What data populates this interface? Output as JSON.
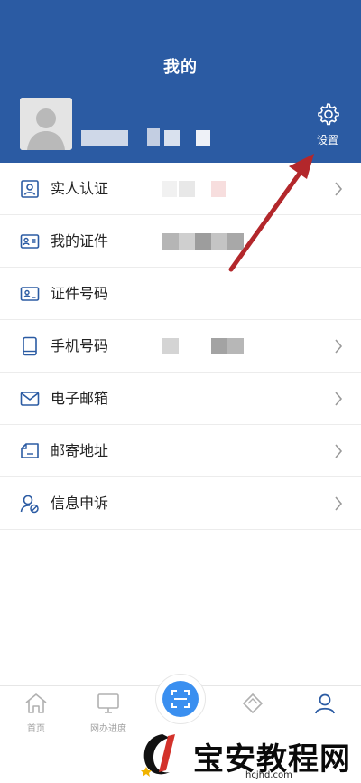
{
  "header": {
    "title": "我的",
    "settings_label": "设置",
    "accent": "#2b5ba3"
  },
  "list": {
    "items": [
      {
        "label": "实人认证",
        "icon": "id-card-person-icon",
        "chevron": true
      },
      {
        "label": "我的证件",
        "icon": "certificate-card-icon",
        "chevron": false
      },
      {
        "label": "证件号码",
        "icon": "id-number-card-icon",
        "chevron": false
      },
      {
        "label": "手机号码",
        "icon": "mobile-phone-icon",
        "chevron": true
      },
      {
        "label": "电子邮箱",
        "icon": "mail-icon",
        "chevron": true
      },
      {
        "label": "邮寄地址",
        "icon": "address-tag-icon",
        "chevron": true
      },
      {
        "label": "信息申诉",
        "icon": "user-appeal-icon",
        "chevron": true
      }
    ]
  },
  "nav": {
    "items": [
      {
        "label": "首页",
        "icon": "home-icon"
      },
      {
        "label": "网办进度",
        "icon": "monitor-icon"
      },
      {
        "label": "",
        "icon": "scan-icon"
      },
      {
        "label": "",
        "icon": "diamond-icon"
      },
      {
        "label": "",
        "icon": "user-icon"
      }
    ],
    "active_color": "#2b5ba3",
    "inactive_color": "#a2a2a2"
  },
  "watermark": {
    "text": "宝安教程网",
    "url": "hcjhd.com"
  },
  "annotation": {
    "arrow_color": "#b3272b"
  }
}
